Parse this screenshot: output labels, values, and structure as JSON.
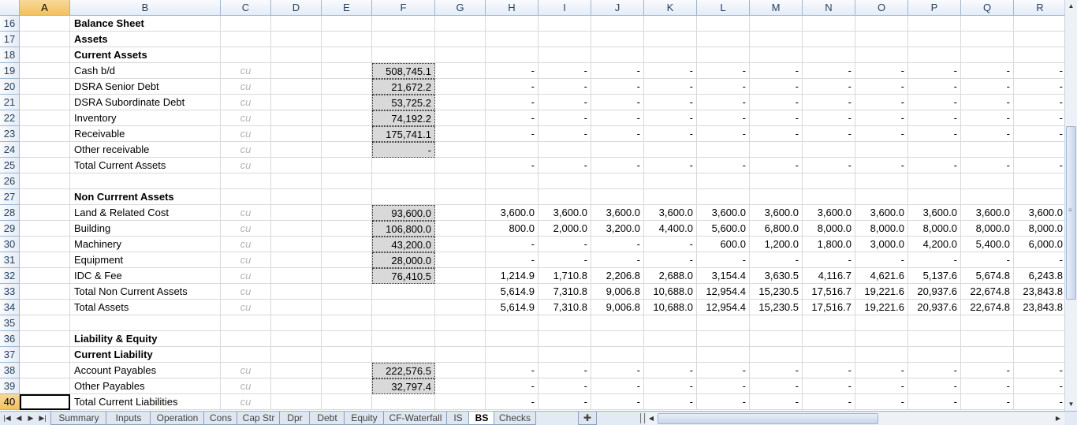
{
  "columns": [
    {
      "id": "A",
      "l": 25,
      "w": 64
    },
    {
      "id": "B",
      "l": 89,
      "w": 191
    },
    {
      "id": "C",
      "l": 280,
      "w": 64
    },
    {
      "id": "D",
      "l": 344,
      "w": 64
    },
    {
      "id": "E",
      "l": 408,
      "w": 64
    },
    {
      "id": "F",
      "l": 472,
      "w": 80
    },
    {
      "id": "G",
      "l": 552,
      "w": 64
    },
    {
      "id": "H",
      "l": 616,
      "w": 67
    },
    {
      "id": "I",
      "l": 683,
      "w": 67
    },
    {
      "id": "J",
      "l": 750,
      "w": 67
    },
    {
      "id": "K",
      "l": 817,
      "w": 67
    },
    {
      "id": "L",
      "l": 884,
      "w": 67
    },
    {
      "id": "M",
      "l": 951,
      "w": 67
    },
    {
      "id": "N",
      "l": 1018,
      "w": 67
    },
    {
      "id": "O",
      "l": 1085,
      "w": 67
    },
    {
      "id": "P",
      "l": 1152,
      "w": 67
    },
    {
      "id": "Q",
      "l": 1219,
      "w": 67
    },
    {
      "id": "R",
      "l": 1286,
      "w": 67
    }
  ],
  "selected_column": "A",
  "selected_row": "40",
  "rows": [
    {
      "n": "16",
      "label": "Balance Sheet",
      "bold": true,
      "unit": "",
      "f": "",
      "input": false,
      "vals": []
    },
    {
      "n": "17",
      "label": "Assets",
      "bold": true,
      "unit": "",
      "f": "",
      "input": false,
      "vals": []
    },
    {
      "n": "18",
      "label": "Current Assets",
      "bold": true,
      "unit": "",
      "f": "",
      "input": false,
      "vals": []
    },
    {
      "n": "19",
      "label": "Cash b/d",
      "bold": false,
      "unit": "cu",
      "f": "508,745.1",
      "input": true,
      "vals": [
        "-",
        "-",
        "-",
        "-",
        "-",
        "-",
        "-",
        "-",
        "-",
        "-",
        "-"
      ]
    },
    {
      "n": "20",
      "label": "DSRA Senior Debt",
      "bold": false,
      "unit": "cu",
      "f": "21,672.2",
      "input": true,
      "vals": [
        "-",
        "-",
        "-",
        "-",
        "-",
        "-",
        "-",
        "-",
        "-",
        "-",
        "-"
      ]
    },
    {
      "n": "21",
      "label": "DSRA Subordinate Debt",
      "bold": false,
      "unit": "cu",
      "f": "53,725.2",
      "input": true,
      "vals": [
        "-",
        "-",
        "-",
        "-",
        "-",
        "-",
        "-",
        "-",
        "-",
        "-",
        "-"
      ]
    },
    {
      "n": "22",
      "label": "Inventory",
      "bold": false,
      "unit": "cu",
      "f": "74,192.2",
      "input": true,
      "vals": [
        "-",
        "-",
        "-",
        "-",
        "-",
        "-",
        "-",
        "-",
        "-",
        "-",
        "-"
      ]
    },
    {
      "n": "23",
      "label": "Receivable",
      "bold": false,
      "unit": "cu",
      "f": "175,741.1",
      "input": true,
      "vals": [
        "-",
        "-",
        "-",
        "-",
        "-",
        "-",
        "-",
        "-",
        "-",
        "-",
        "-"
      ]
    },
    {
      "n": "24",
      "label": "Other receivable",
      "bold": false,
      "unit": "cu",
      "f": "-",
      "input": true,
      "vals": []
    },
    {
      "n": "25",
      "label": "Total Current Assets",
      "bold": false,
      "unit": "cu",
      "f": "",
      "input": false,
      "vals": [
        "-",
        "-",
        "-",
        "-",
        "-",
        "-",
        "-",
        "-",
        "-",
        "-",
        "-"
      ]
    },
    {
      "n": "26",
      "label": "",
      "bold": false,
      "unit": "",
      "f": "",
      "input": false,
      "vals": []
    },
    {
      "n": "27",
      "label": "Non Currrent Assets",
      "bold": true,
      "unit": "",
      "f": "",
      "input": false,
      "vals": []
    },
    {
      "n": "28",
      "label": "Land & Related Cost",
      "bold": false,
      "unit": "cu",
      "f": "93,600.0",
      "input": true,
      "vals": [
        "3,600.0",
        "3,600.0",
        "3,600.0",
        "3,600.0",
        "3,600.0",
        "3,600.0",
        "3,600.0",
        "3,600.0",
        "3,600.0",
        "3,600.0",
        "3,600.0"
      ]
    },
    {
      "n": "29",
      "label": "Building",
      "bold": false,
      "unit": "cu",
      "f": "106,800.0",
      "input": true,
      "vals": [
        "800.0",
        "2,000.0",
        "3,200.0",
        "4,400.0",
        "5,600.0",
        "6,800.0",
        "8,000.0",
        "8,000.0",
        "8,000.0",
        "8,000.0",
        "8,000.0"
      ]
    },
    {
      "n": "30",
      "label": "Machinery",
      "bold": false,
      "unit": "cu",
      "f": "43,200.0",
      "input": true,
      "vals": [
        "-",
        "-",
        "-",
        "-",
        "600.0",
        "1,200.0",
        "1,800.0",
        "3,000.0",
        "4,200.0",
        "5,400.0",
        "6,000.0"
      ]
    },
    {
      "n": "31",
      "label": "Equipment",
      "bold": false,
      "unit": "cu",
      "f": "28,000.0",
      "input": true,
      "vals": [
        "-",
        "-",
        "-",
        "-",
        "-",
        "-",
        "-",
        "-",
        "-",
        "-",
        "-"
      ]
    },
    {
      "n": "32",
      "label": "IDC & Fee",
      "bold": false,
      "unit": "cu",
      "f": "76,410.5",
      "input": true,
      "vals": [
        "1,214.9",
        "1,710.8",
        "2,206.8",
        "2,688.0",
        "3,154.4",
        "3,630.5",
        "4,116.7",
        "4,621.6",
        "5,137.6",
        "5,674.8",
        "6,243.8"
      ]
    },
    {
      "n": "33",
      "label": "Total Non Current Assets",
      "bold": false,
      "unit": "cu",
      "f": "",
      "input": false,
      "vals": [
        "5,614.9",
        "7,310.8",
        "9,006.8",
        "10,688.0",
        "12,954.4",
        "15,230.5",
        "17,516.7",
        "19,221.6",
        "20,937.6",
        "22,674.8",
        "23,843.8"
      ]
    },
    {
      "n": "34",
      "label": "Total Assets",
      "bold": false,
      "unit": "cu",
      "f": "",
      "input": false,
      "vals": [
        "5,614.9",
        "7,310.8",
        "9,006.8",
        "10,688.0",
        "12,954.4",
        "15,230.5",
        "17,516.7",
        "19,221.6",
        "20,937.6",
        "22,674.8",
        "23,843.8"
      ]
    },
    {
      "n": "35",
      "label": "",
      "bold": false,
      "unit": "",
      "f": "",
      "input": false,
      "vals": []
    },
    {
      "n": "36",
      "label": "Liability & Equity",
      "bold": true,
      "unit": "",
      "f": "",
      "input": false,
      "vals": []
    },
    {
      "n": "37",
      "label": "Current Liability",
      "bold": true,
      "unit": "",
      "f": "",
      "input": false,
      "vals": []
    },
    {
      "n": "38",
      "label": "Account Payables",
      "bold": false,
      "unit": "cu",
      "f": "222,576.5",
      "input": true,
      "vals": [
        "-",
        "-",
        "-",
        "-",
        "-",
        "-",
        "-",
        "-",
        "-",
        "-",
        "-"
      ]
    },
    {
      "n": "39",
      "label": "Other Payables",
      "bold": false,
      "unit": "cu",
      "f": "32,797.4",
      "input": true,
      "vals": [
        "-",
        "-",
        "-",
        "-",
        "-",
        "-",
        "-",
        "-",
        "-",
        "-",
        "-"
      ]
    },
    {
      "n": "40",
      "label": "Total Current Liabilities",
      "bold": false,
      "unit": "cu",
      "f": "",
      "input": false,
      "vals": [
        "-",
        "-",
        "-",
        "-",
        "-",
        "-",
        "-",
        "-",
        "-",
        "-",
        "-"
      ]
    }
  ],
  "sheet_tabs": [
    {
      "label": "Summary",
      "active": false
    },
    {
      "label": "Inputs",
      "active": false
    },
    {
      "label": "Operation",
      "active": false
    },
    {
      "label": "Cons",
      "active": false
    },
    {
      "label": "Cap Str",
      "active": false
    },
    {
      "label": "Dpr",
      "active": false
    },
    {
      "label": "Debt",
      "active": false
    },
    {
      "label": "Equity",
      "active": false
    },
    {
      "label": "CF-Waterfall",
      "active": false
    },
    {
      "label": "IS",
      "active": false
    },
    {
      "label": "BS",
      "active": true
    },
    {
      "label": "Checks",
      "active": false
    }
  ],
  "nav_icons": [
    "first-sheet-icon",
    "prev-sheet-icon",
    "next-sheet-icon",
    "last-sheet-icon"
  ],
  "colors": {
    "input_fill": "#d9d9d9",
    "header_bg": "#e4ecf7",
    "selected_header": "#f1c15f",
    "grid": "#d9d9d9"
  }
}
